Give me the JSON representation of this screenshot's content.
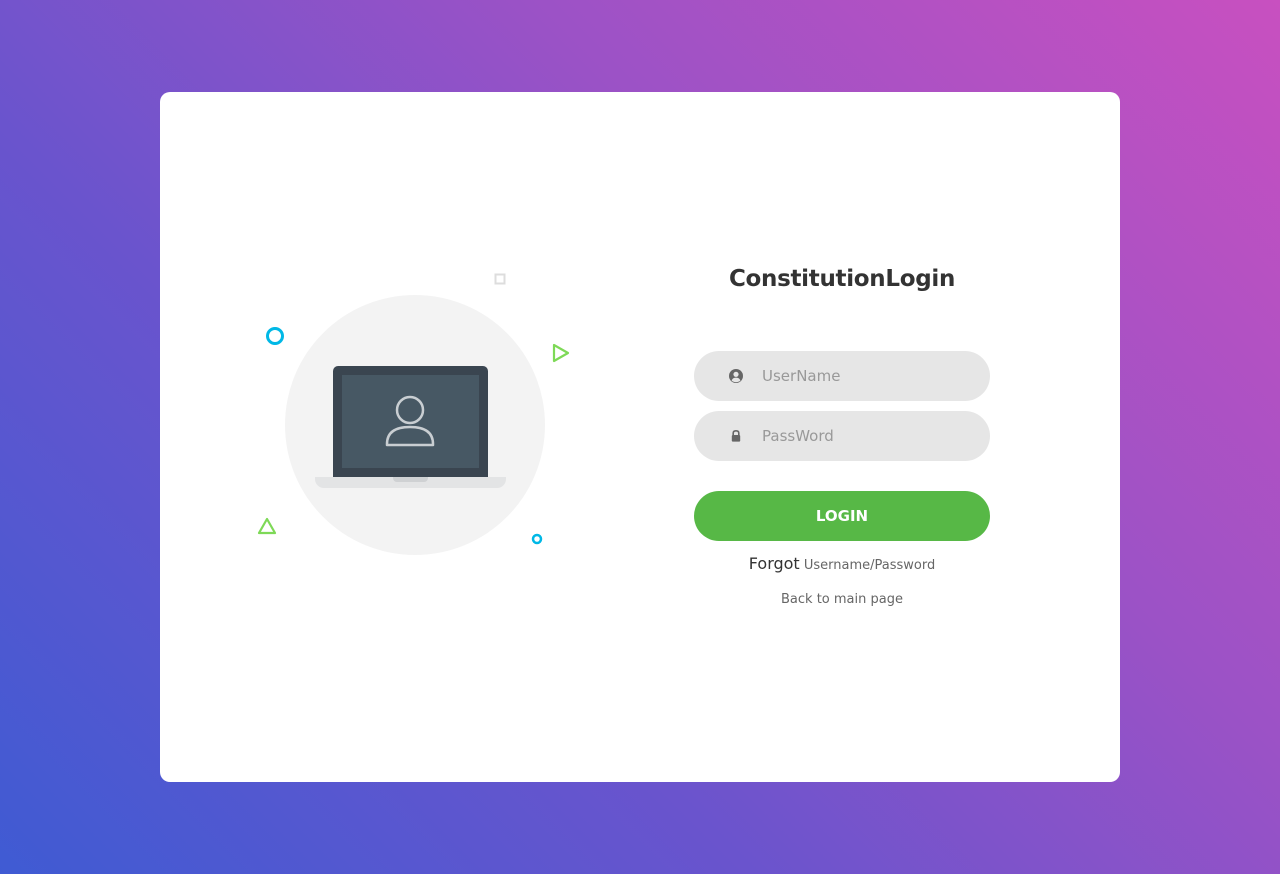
{
  "colors": {
    "background_gradient_start": "#3f5bd3",
    "background_gradient_end": "#c850c0",
    "card": "#ffffff",
    "accent_green": "#57b846",
    "input_background": "#e6e6e6",
    "deco_cyan": "#00b8e6",
    "deco_green": "#7ed957"
  },
  "illustration": {
    "image_icon": "laptop-user-icon",
    "decorations": [
      "circle-outline-icon",
      "square-outline-icon",
      "play-triangle-icon",
      "triangle-outline-icon",
      "small-circle-icon"
    ]
  },
  "login_form": {
    "title": "ConstitutionLogin",
    "username": {
      "icon": "user-circle-icon",
      "placeholder": "UserName",
      "value": ""
    },
    "password": {
      "icon": "lock-icon",
      "placeholder": "PassWord",
      "value": ""
    },
    "login_button": "LOGIN",
    "forgot": {
      "lead": "Forgot",
      "link": "Username/Password"
    },
    "back_link": "Back to main page"
  }
}
